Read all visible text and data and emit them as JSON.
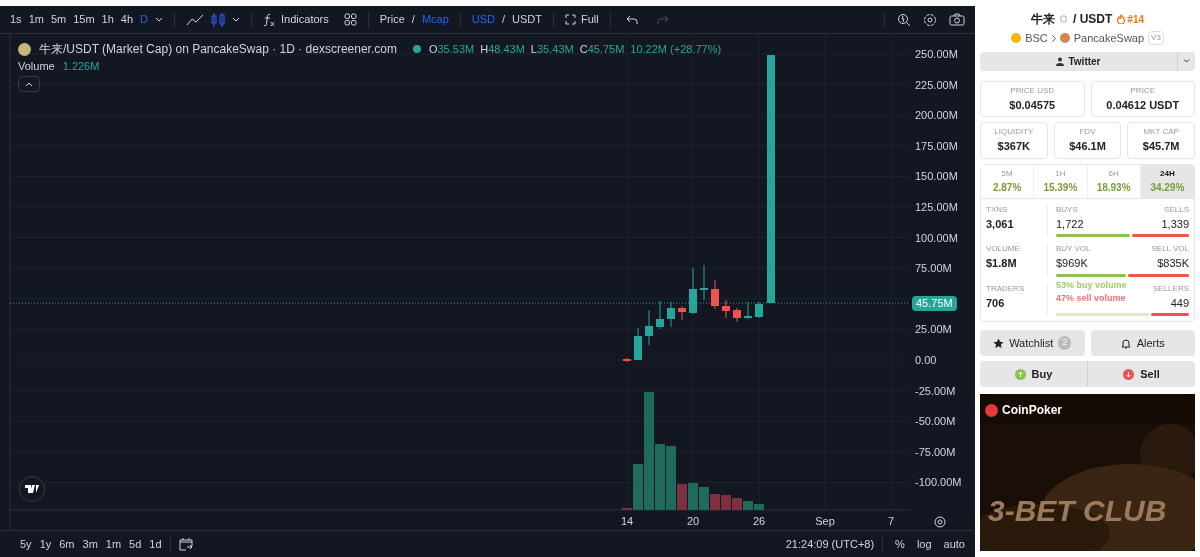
{
  "toolbar": {
    "intervals": [
      {
        "label": "1s",
        "selected": false
      },
      {
        "label": "1m",
        "selected": false
      },
      {
        "label": "5m",
        "selected": false
      },
      {
        "label": "15m",
        "selected": false
      },
      {
        "label": "1h",
        "selected": false
      },
      {
        "label": "4h",
        "selected": false
      },
      {
        "label": "D",
        "selected": true
      }
    ],
    "indicators": "Indicators",
    "price_toggle": [
      {
        "label": "Price",
        "selected": false
      },
      {
        "label": "Mcap",
        "selected": true
      }
    ],
    "currency_toggle": [
      {
        "label": "USD",
        "selected": true
      },
      {
        "label": "USDT",
        "selected": false
      }
    ],
    "separator": "/",
    "full": "Full"
  },
  "legend": {
    "title": "牛来/USDT (Market Cap) on PancakeSwap · 1D · dexscreener.com",
    "ohlc": [
      {
        "key": "O",
        "value": "35.53M"
      },
      {
        "key": "H",
        "value": "48.43M"
      },
      {
        "key": "L",
        "value": "35.43M"
      },
      {
        "key": "C",
        "value": "45.75M"
      }
    ],
    "change": "10.22M (+28.77%)",
    "volume_label": "Volume",
    "volume_value": "1.226M"
  },
  "y_axis": [
    "250.00M",
    "225.00M",
    "200.00M",
    "175.00M",
    "150.00M",
    "125.00M",
    "100.00M",
    "75.00M",
    "25.00M",
    "0.00",
    "-25.00M",
    "-50.00M",
    "-75.00M",
    "-100.00M"
  ],
  "price_badge": "45.75M",
  "x_axis": [
    "14",
    "20",
    "26",
    "Sep",
    "7"
  ],
  "bottom_bar": {
    "ranges": [
      "5y",
      "1y",
      "6m",
      "3m",
      "1m",
      "5d",
      "1d"
    ],
    "time": "21:24:09 (UTC+8)",
    "options": [
      "%",
      "log",
      "auto"
    ]
  },
  "pair": {
    "base": "牛来",
    "quote": "/ USDT",
    "rank": "#14",
    "chain": "BSC",
    "dex": "PancakeSwap",
    "version": "V3",
    "social": "Twitter"
  },
  "prices": [
    {
      "label": "PRICE USD",
      "value": "$0.04575"
    },
    {
      "label": "PRICE",
      "value": "0.04612 USDT"
    }
  ],
  "stats": [
    {
      "label": "LIQUIDITY",
      "value": "$367K"
    },
    {
      "label": "FDV",
      "value": "$46.1M"
    },
    {
      "label": "MKT CAP",
      "value": "$45.7M"
    }
  ],
  "timeframes": [
    {
      "label": "5M",
      "change": "2.87%",
      "selected": false
    },
    {
      "label": "1H",
      "change": "15.39%",
      "selected": false
    },
    {
      "label": "6H",
      "change": "18.93%",
      "selected": false
    },
    {
      "label": "24H",
      "change": "34.29%",
      "selected": true
    }
  ],
  "activity": [
    {
      "label": "TXNS",
      "value": "3,061",
      "left_label": "BUYS",
      "left_value": "1,722",
      "right_label": "SELLS",
      "right_value": "1,339",
      "level": 0.56
    },
    {
      "label": "VOLUME",
      "value": "$1.8M",
      "left_label": "BUY VOL",
      "left_value": "$969K",
      "right_label": "SELL VOL",
      "right_value": "$835K",
      "level": 0.53
    },
    {
      "label": "TRADERS",
      "value": "706",
      "right_label": "SELLERS",
      "right_value": "449",
      "level": 0.7
    }
  ],
  "tooltip": [
    "53% buy volume",
    "47% sell volume"
  ],
  "watchlist": {
    "label": "Watchlist",
    "count": "2"
  },
  "alerts": "Alerts",
  "trade": [
    "Buy",
    "Sell"
  ],
  "ad": {
    "brand": "CoinPoker",
    "headline": "3-BET CLUB"
  }
}
